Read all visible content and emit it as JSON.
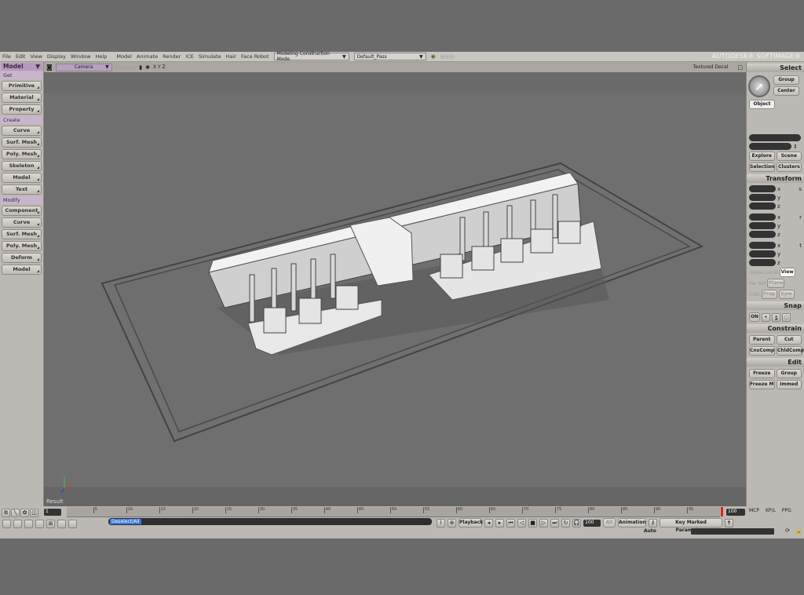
{
  "menubar": {
    "items": [
      "File",
      "Edit",
      "View",
      "Display",
      "Window",
      "Help",
      "Model",
      "Animate",
      "Render",
      "ICE",
      "Simulate",
      "Hair",
      "Face Robot"
    ],
    "construction_mode": "Modeling Construction Mode",
    "pass": "Default_Pass",
    "brand": "AUTODESK® SOFTIMAGE®"
  },
  "left_panel": {
    "module": "Model",
    "sections": [
      {
        "title": "Get",
        "buttons": [
          "Primitive",
          "Material",
          "Property"
        ]
      },
      {
        "title": "Create",
        "buttons": [
          "Curve",
          "Surf. Mesh",
          "Poly. Mesh",
          "Skeleton",
          "Model",
          "Text"
        ]
      },
      {
        "title": "Modify",
        "buttons": [
          "Component",
          "Curve",
          "Surf. Mesh",
          "Poly. Mesh",
          "Deform",
          "Model"
        ]
      }
    ]
  },
  "viewport": {
    "camera": "Camera",
    "axes": "X Y Z",
    "display_mode": "Textured Decal",
    "result_label": "Result"
  },
  "right_panel": {
    "select": {
      "title": "Select",
      "group": "Group",
      "center": "Center",
      "object": "Object",
      "explore": "Explore",
      "scene": "Scene",
      "selection": "Selection",
      "clusters": "Clusters"
    },
    "transform": {
      "title": "Transform",
      "axes": [
        "x",
        "y",
        "z"
      ],
      "modes": [
        "s",
        "r",
        "t"
      ],
      "global": "Global",
      "local": "Local",
      "view": "View",
      "par": "Par",
      "ref": "Ref",
      "plane": "Plane",
      "cog": "COG",
      "prop": "Prop",
      "sym": "Sym"
    },
    "snap": {
      "title": "Snap",
      "on": "ON"
    },
    "constrain": {
      "title": "Constrain",
      "buttons": [
        "Parent",
        "Cut",
        "CnsComp",
        "ChldComp"
      ]
    },
    "edit": {
      "title": "Edit",
      "buttons": [
        "Freeze",
        "Group",
        "Freeze M",
        "Immed"
      ]
    }
  },
  "timeline": {
    "start_frame": "1",
    "end_frame": "100",
    "ticks": [
      "5",
      "10",
      "15",
      "20",
      "25",
      "30",
      "35",
      "40",
      "45",
      "50",
      "55",
      "60",
      "65",
      "70",
      "75",
      "80",
      "85",
      "90",
      "95"
    ],
    "command": "Deselect/All",
    "playback": "Playback",
    "frame_field": "100",
    "all": "All",
    "animation": "Animation",
    "auto": "Auto",
    "key_marked": "Key Marked Parameters",
    "tabs": [
      "MCP",
      "KP/L",
      "PPG"
    ]
  }
}
